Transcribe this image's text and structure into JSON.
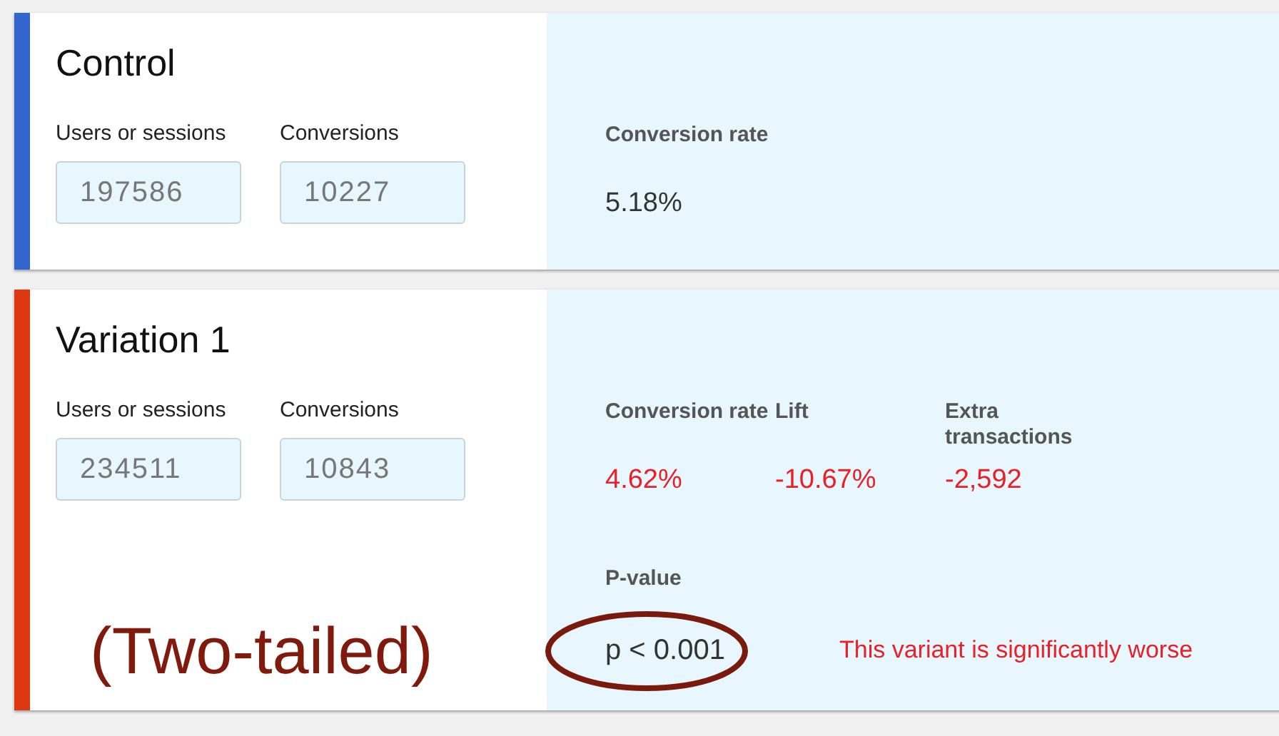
{
  "variants": [
    {
      "name": "Control",
      "color": "#3366cc",
      "inputs": [
        {
          "label": "Users or sessions",
          "placeholder": "197586"
        },
        {
          "label": "Conversions",
          "placeholder": "10227"
        }
      ],
      "metrics": [
        {
          "label": "Conversion rate",
          "value": "5.18%",
          "negative": false
        }
      ]
    },
    {
      "name": "Variation 1",
      "color": "#dc3912",
      "inputs": [
        {
          "label": "Users or sessions",
          "placeholder": "234511"
        },
        {
          "label": "Conversions",
          "placeholder": "10843"
        }
      ],
      "metrics": [
        {
          "label": "Conversion rate",
          "value": "4.62%",
          "negative": true
        },
        {
          "label": "Lift",
          "value": "-10.67%",
          "negative": true
        },
        {
          "label": "Extra transactions",
          "value": "-2,592",
          "negative": true
        }
      ],
      "p_value": {
        "label": "P-value",
        "value": "p < 0.001",
        "circled": true
      },
      "verdict": {
        "text": "This variant is significantly worse",
        "negative": true
      },
      "annotation": "(Two-tailed)"
    }
  ]
}
